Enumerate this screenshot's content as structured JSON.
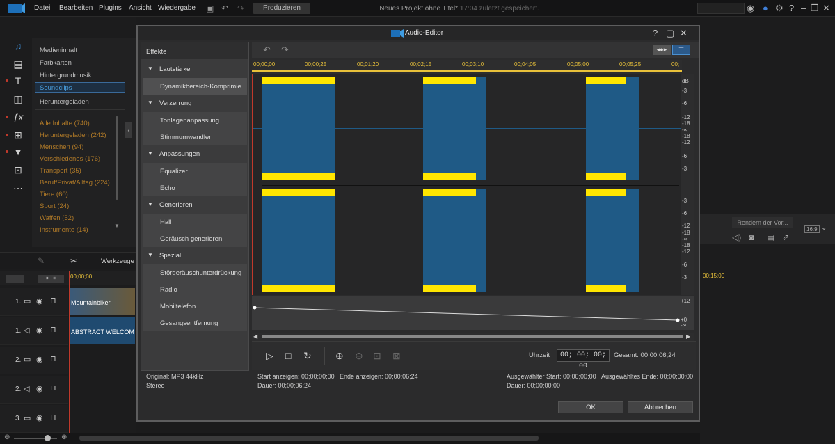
{
  "menu": [
    "Datei",
    "Bearbeiten",
    "Plugins",
    "Ansicht",
    "Wiedergabe"
  ],
  "produce_label": "Produzieren",
  "project": {
    "title": "Neues Projekt ohne Titel*",
    "saved": "17:04 zuletzt gespeichert."
  },
  "library": {
    "items": [
      "Medieninhalt",
      "Farbkarten",
      "Hintergrundmusik",
      "Soundclips",
      "Heruntergeladen"
    ],
    "selected": "Soundclips",
    "categories": [
      "Alle Inhalte  (740)",
      "Heruntergeladen  (242)",
      "Menschen  (94)",
      "Verschiedenes  (176)",
      "Transport  (35)",
      "Beruf/Privat/Alltag  (224)",
      "Tiere  (60)",
      "Sport  (24)",
      "Waffen  (52)",
      "Instrumente  (14)"
    ]
  },
  "timeline": {
    "tools_label": "Werkzeuge",
    "start_time": "00;00;00",
    "end_time": "00;15;00",
    "tracks": [
      "1.",
      "1.",
      "2.",
      "2.",
      "3."
    ],
    "clips": [
      "Mountainbiker",
      "ABSTRACT WELCOM"
    ]
  },
  "render_preview": "Rendern der Vor...",
  "aspect": "16:9",
  "dialog": {
    "title": "Audio-Editor",
    "effects_header": "Effekte",
    "groups": [
      {
        "label": "Lautstärke",
        "items": [
          "Dynamikbereich-Komprimie..."
        ]
      },
      {
        "label": "Verzerrung",
        "items": [
          "Tonlagenanpassung",
          "Stimmumwandler"
        ]
      },
      {
        "label": "Anpassungen",
        "items": [
          "Equalizer",
          "Echo"
        ]
      },
      {
        "label": "Generieren",
        "items": [
          "Hall",
          "Geräusch generieren"
        ]
      },
      {
        "label": "Spezial",
        "items": [
          "Störgeräuschunterdrückung",
          "Radio",
          "Mobiltelefon",
          "Gesangsentfernung"
        ]
      }
    ],
    "ruler": [
      "00;00;00",
      "00;00;25",
      "00;01;20",
      "00;02;15",
      "00;03;10",
      "00;04;05",
      "00;05;00",
      "00;05;25",
      "00;"
    ],
    "db_unit": "dB",
    "db_top": [
      "-3",
      "-6",
      "-12",
      "-18",
      "-∞",
      "-18",
      "-12",
      "-6",
      "-3"
    ],
    "db_bottom": [
      "-3",
      "-6",
      "-12",
      "-18",
      "-∞",
      "-18",
      "-12",
      "-6",
      "-3"
    ],
    "env_top": "+12",
    "env_mid": "+0",
    "env_bottom": "-∞",
    "time_label": "Uhrzeit",
    "time_value": "00; 00; 00; 00",
    "total": "Gesamt: 00;00;06;24",
    "info": {
      "original": "Original: MP3 44kHz",
      "channels": "Stereo",
      "start_show": "Start anzeigen: 00;00;00;00",
      "end_show": "Ende anzeigen: 00;00;06;24",
      "duration": "Dauer: 00;00;06;24",
      "sel_start": "Ausgewählter Start: 00;00;00;00",
      "sel_end": "Ausgewähltes Ende: 00;00;00;00",
      "sel_duration": "Dauer: 00;00;00;00"
    },
    "ok": "OK",
    "cancel": "Abbrechen"
  },
  "colors": {
    "accent": "#3f8fd8",
    "wave": "#1f5a86",
    "peak": "#ffe600",
    "category": "#b07a28"
  }
}
